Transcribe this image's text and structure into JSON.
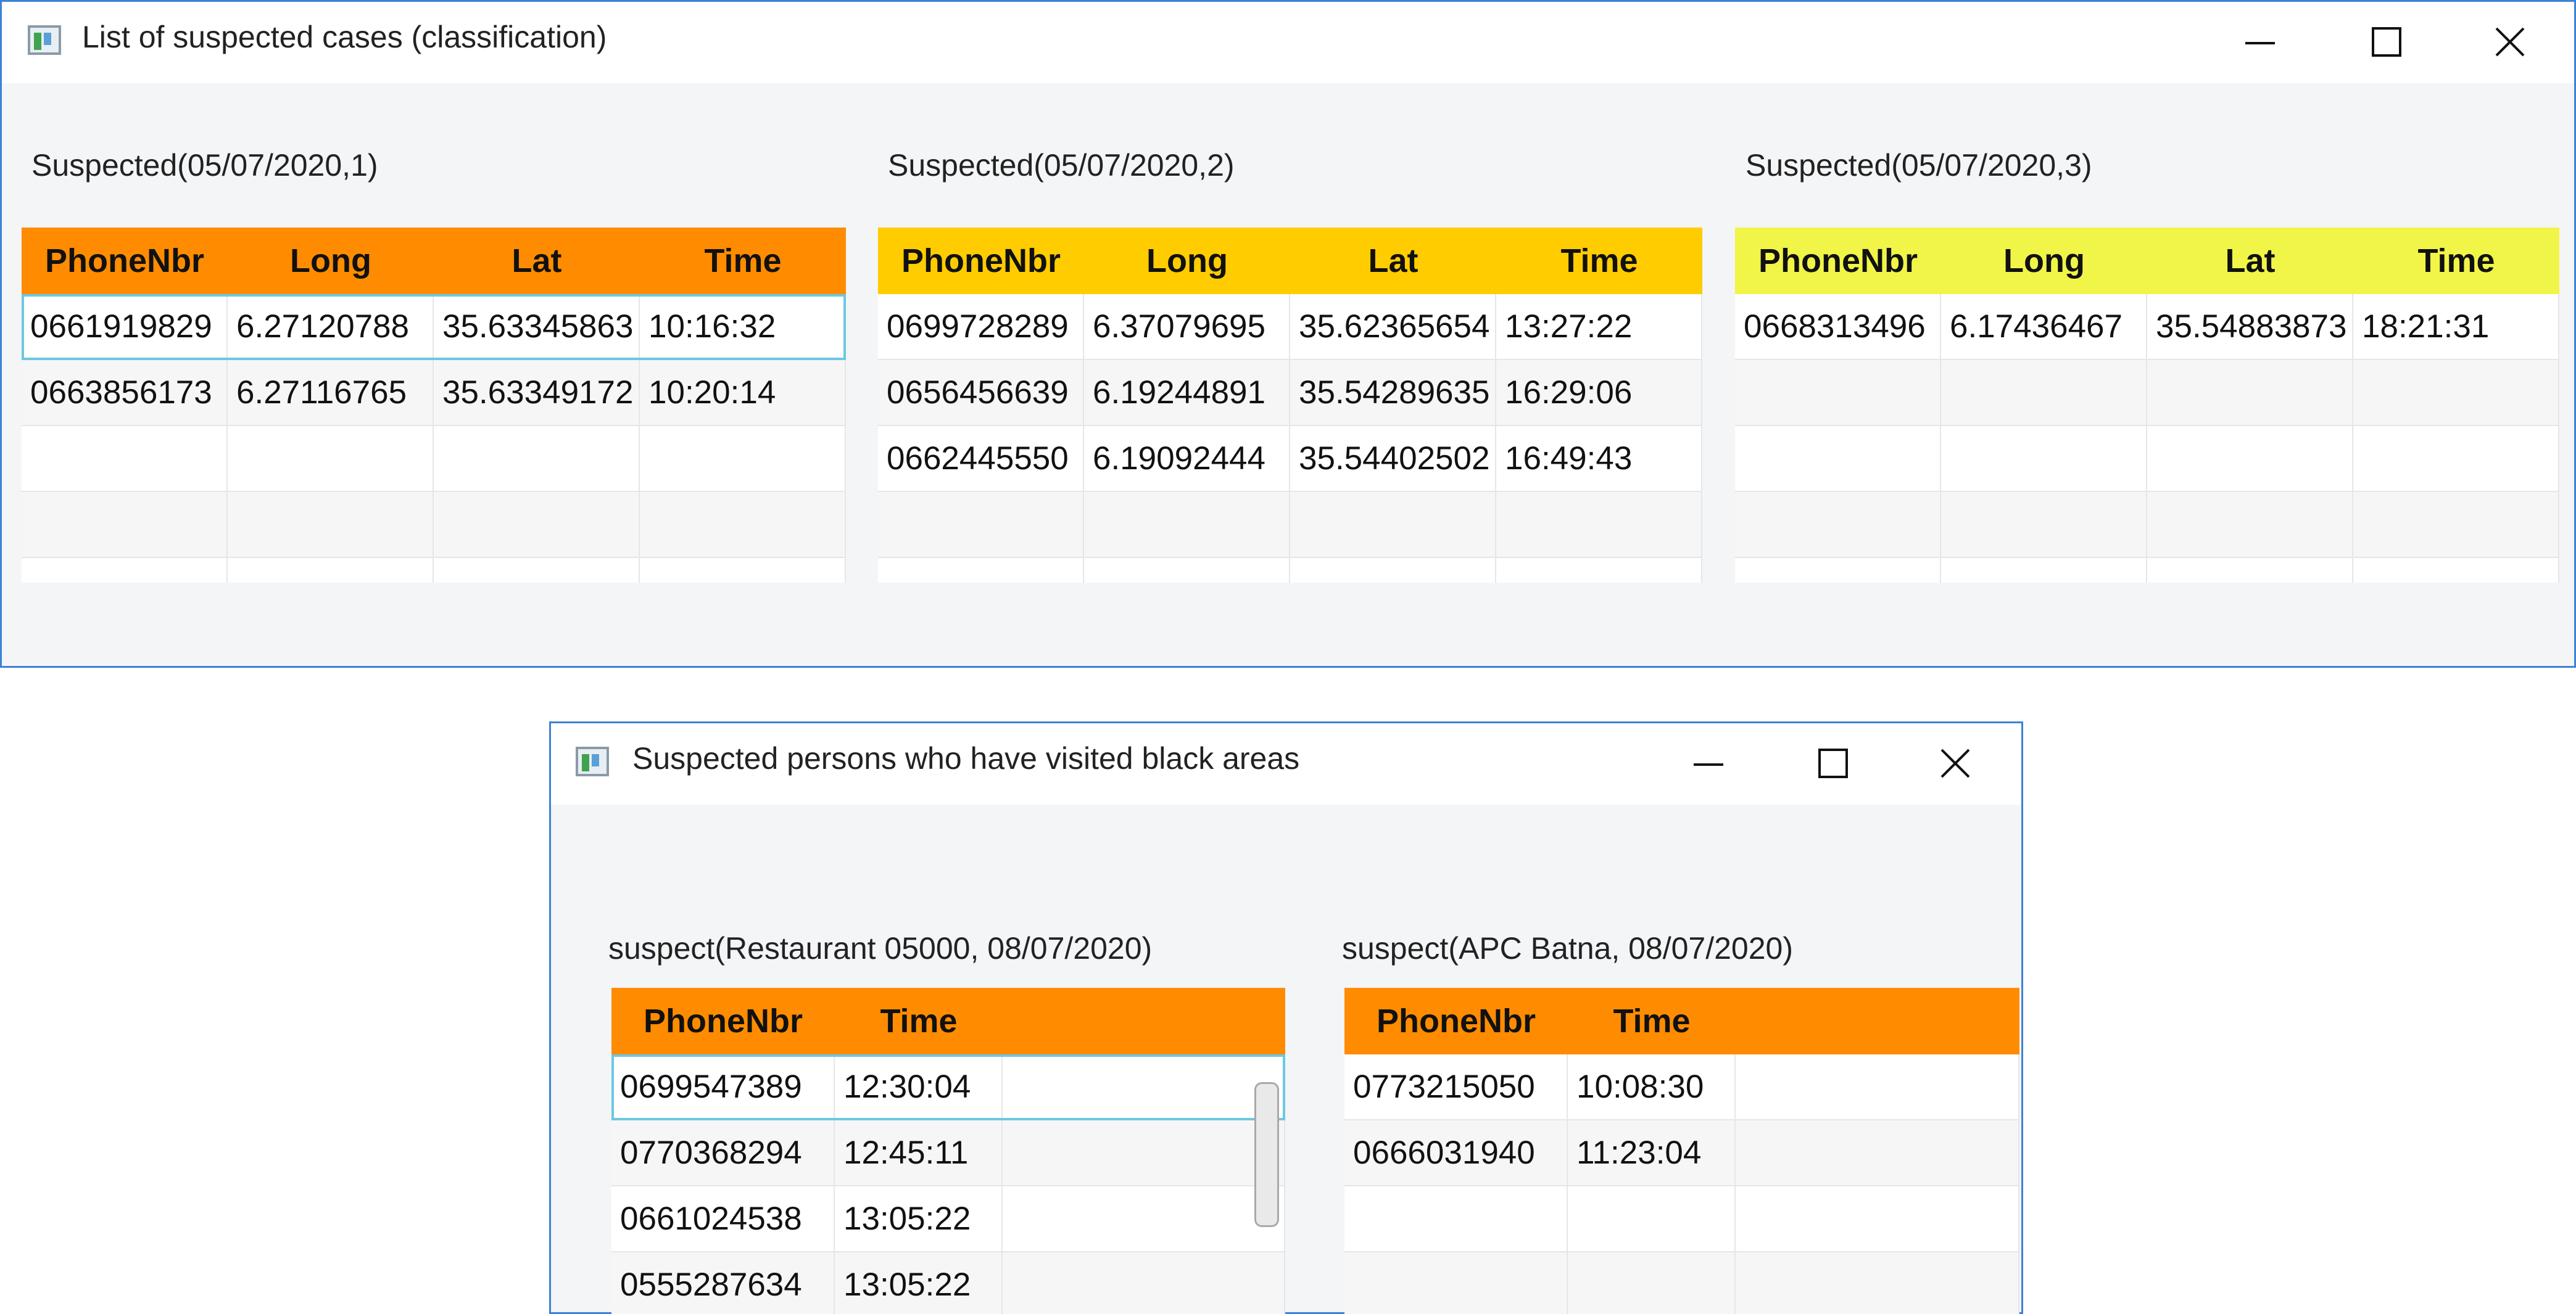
{
  "window1": {
    "title": "List of suspected cases (classification)",
    "columns": [
      "PhoneNbr",
      "Long",
      "Lat",
      "Time"
    ],
    "tables": [
      {
        "caption": "Suspected(05/07/2020,1)",
        "header_color": "#ff8c00",
        "rows": [
          [
            "0661919829",
            "6.27120788",
            "35.63345863",
            "10:16:32"
          ],
          [
            "0663856173",
            "6.27116765",
            "35.63349172",
            "10:20:14"
          ],
          [
            "",
            "",
            "",
            ""
          ],
          [
            "",
            "",
            "",
            ""
          ],
          [
            "",
            "",
            "",
            ""
          ]
        ]
      },
      {
        "caption": "Suspected(05/07/2020,2)",
        "header_color": "#ffcc00",
        "rows": [
          [
            "0699728289",
            "6.37079695",
            "35.62365654",
            "13:27:22"
          ],
          [
            "0656456639",
            "6.19244891",
            "35.54289635",
            "16:29:06"
          ],
          [
            "0662445550",
            "6.19092444",
            "35.54402502",
            "16:49:43"
          ],
          [
            "",
            "",
            "",
            ""
          ],
          [
            "",
            "",
            "",
            ""
          ]
        ]
      },
      {
        "caption": "Suspected(05/07/2020,3)",
        "header_color": "#f1f547",
        "rows": [
          [
            "0668313496",
            "6.17436467",
            "35.54883873",
            "18:21:31"
          ],
          [
            "",
            "",
            "",
            ""
          ],
          [
            "",
            "",
            "",
            ""
          ],
          [
            "",
            "",
            "",
            ""
          ],
          [
            "",
            "",
            "",
            ""
          ]
        ]
      }
    ]
  },
  "window2": {
    "title": "Suspected persons who have visited black areas",
    "columns": [
      "PhoneNbr",
      "Time"
    ],
    "tables": [
      {
        "caption": "suspect(Restaurant 05000, 08/07/2020)",
        "header_color": "#ff8c00",
        "rows": [
          [
            "0699547389",
            "12:30:04"
          ],
          [
            "0770368294",
            "12:45:11"
          ],
          [
            "0661024538",
            "13:05:22"
          ],
          [
            "0555287634",
            "13:05:22"
          ]
        ]
      },
      {
        "caption": "suspect(APC Batna, 08/07/2020)",
        "header_color": "#ff8c00",
        "rows": [
          [
            "0773215050",
            "10:08:30"
          ],
          [
            "0666031940",
            "11:23:04"
          ],
          [
            "",
            ""
          ],
          [
            "",
            ""
          ]
        ]
      }
    ]
  }
}
